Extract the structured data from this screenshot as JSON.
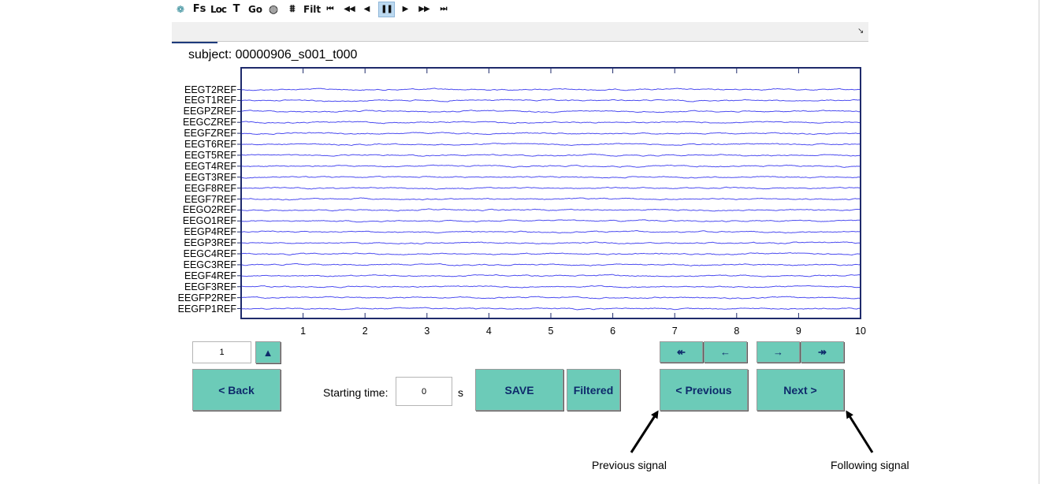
{
  "toolbar": {
    "items": [
      {
        "name": "rotate-icon",
        "glyph": "❁"
      },
      {
        "name": "fs",
        "glyph": "Fs"
      },
      {
        "name": "loc",
        "glyph": "Loc"
      },
      {
        "name": "t",
        "glyph": "T"
      },
      {
        "name": "go",
        "glyph": "Go"
      },
      {
        "name": "globe-icon",
        "glyph": "◍"
      },
      {
        "name": "spectrum-icon",
        "glyph": "⩩"
      },
      {
        "name": "filt",
        "glyph": "Filt"
      },
      {
        "name": "first-icon",
        "glyph": "⏮"
      },
      {
        "name": "fast-back-icon",
        "glyph": "◀◀"
      },
      {
        "name": "back-icon",
        "glyph": "◀"
      },
      {
        "name": "pause-icon",
        "glyph": "❚❚"
      },
      {
        "name": "play-icon",
        "glyph": "▶"
      },
      {
        "name": "fast-forward-icon",
        "glyph": "▶▶"
      },
      {
        "name": "last-icon",
        "glyph": "⏭"
      }
    ],
    "corner_glyph": "↘"
  },
  "subject": "subject:  00000906_s001_t000",
  "channels": [
    "EEGT2REF",
    "EEGT1REF",
    "EEGPZREF",
    "EEGCZREF",
    "EEGFZREF",
    "EEGT6REF",
    "EEGT5REF",
    "EEGT4REF",
    "EEGT3REF",
    "EEGF8REF",
    "EEGF7REF",
    "EEGO2REF",
    "EEGO1REF",
    "EEGP4REF",
    "EEGP3REF",
    "EEGC4REF",
    "EEGC3REF",
    "EEGF4REF",
    "EEGF3REF",
    "EEGFP2REF",
    "EEGFP1REF"
  ],
  "x_ticks": [
    "1",
    "2",
    "3",
    "4",
    "5",
    "6",
    "7",
    "8",
    "9",
    "10"
  ],
  "x_range": [
    0,
    10
  ],
  "signal_color": "#3a3aee",
  "controls": {
    "page_value": "1",
    "up_glyph": "▲",
    "back_label": "<  Back",
    "starting_time_label": "Starting time:",
    "starting_time_value": "0",
    "seconds_unit": "s",
    "save_label": "SAVE",
    "filtered_label": "Filtered",
    "previous_label": "< Previous",
    "next_label": "Next  >",
    "skip_back_glyph": "↞",
    "step_back_glyph": "←",
    "step_forward_glyph": "→",
    "skip_forward_glyph": "↠"
  },
  "annotations": {
    "previous_signal": "Previous signal",
    "following_signal": "Following signal"
  },
  "button_color": "#6ccbb8"
}
